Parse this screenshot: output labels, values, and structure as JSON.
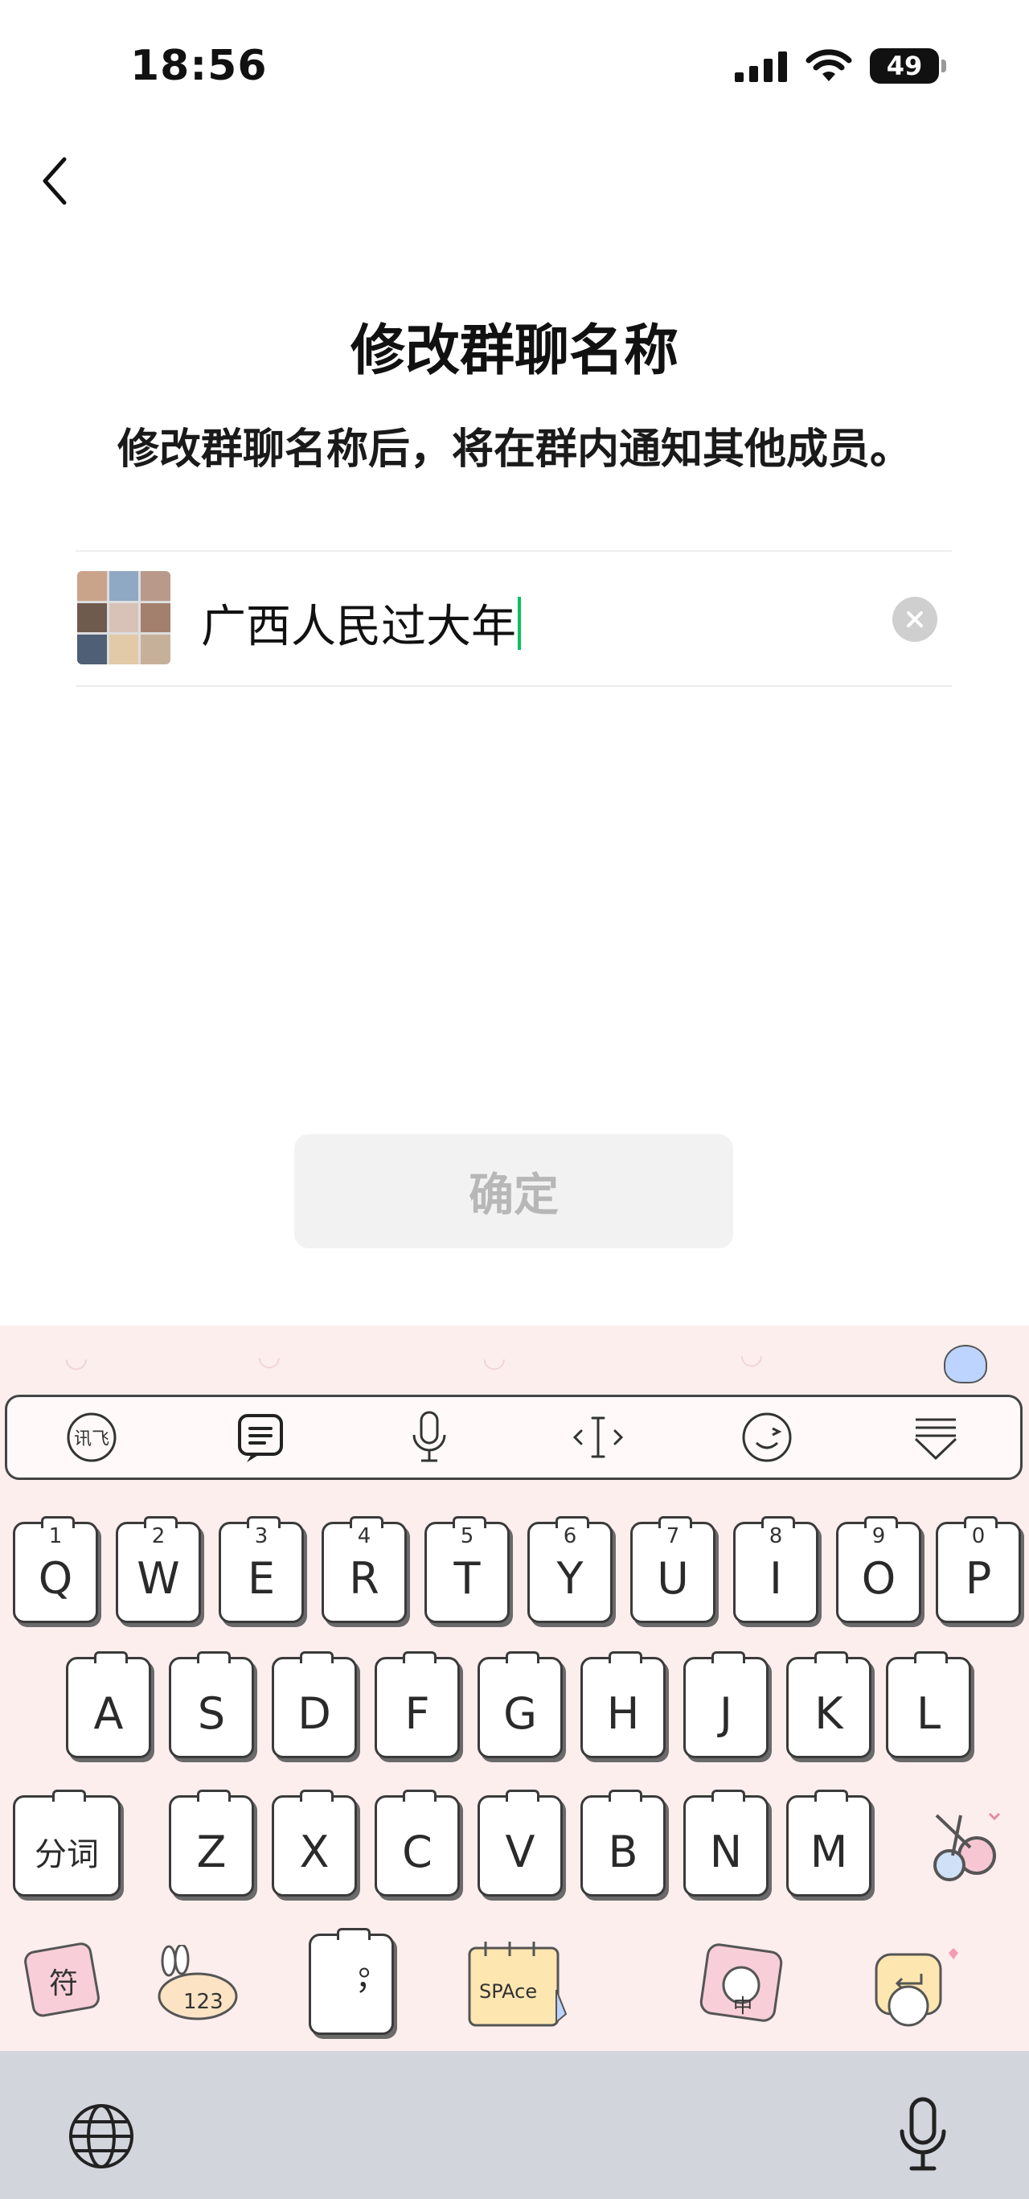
{
  "status_bar": {
    "time": "18:56",
    "battery": "49"
  },
  "nav": {
    "back_icon": "chevron-left-icon"
  },
  "header": {
    "title": "修改群聊名称",
    "subtitle": "修改群聊名称后，将在群内通知其他成员。"
  },
  "group_name": {
    "value": "广西人民过大年"
  },
  "confirm_button": {
    "label": "确定"
  },
  "keyboard": {
    "toolbar": [
      "xunfei-logo-icon",
      "clipboard-icon",
      "microphone-icon",
      "cursor-move-icon",
      "emoji-icon",
      "collapse-keyboard-icon"
    ],
    "toolbar_logo_text": "讯飞",
    "row1": [
      {
        "letter": "Q",
        "num": "1"
      },
      {
        "letter": "W",
        "num": "2"
      },
      {
        "letter": "E",
        "num": "3"
      },
      {
        "letter": "R",
        "num": "4"
      },
      {
        "letter": "T",
        "num": "5"
      },
      {
        "letter": "Y",
        "num": "6"
      },
      {
        "letter": "U",
        "num": "7"
      },
      {
        "letter": "I",
        "num": "8"
      },
      {
        "letter": "O",
        "num": "9"
      },
      {
        "letter": "P",
        "num": "0"
      }
    ],
    "row2": [
      "A",
      "S",
      "D",
      "F",
      "G",
      "H",
      "J",
      "K",
      "L"
    ],
    "row3": [
      "Z",
      "X",
      "C",
      "V",
      "B",
      "N",
      "M"
    ],
    "segment_label": "分词",
    "bottom_row": {
      "symbol_label": "符",
      "numbers_label": "123",
      "punct_label": "。，",
      "space_label": "SPAce",
      "lang_label": "中"
    }
  },
  "system_bar": {
    "left_icon": "globe-icon",
    "right_icon": "microphone-icon"
  },
  "colors": {
    "accent": "#07c160",
    "keyboard_bg": "#fdeeee",
    "confirm_disabled_bg": "#f2f2f2"
  }
}
